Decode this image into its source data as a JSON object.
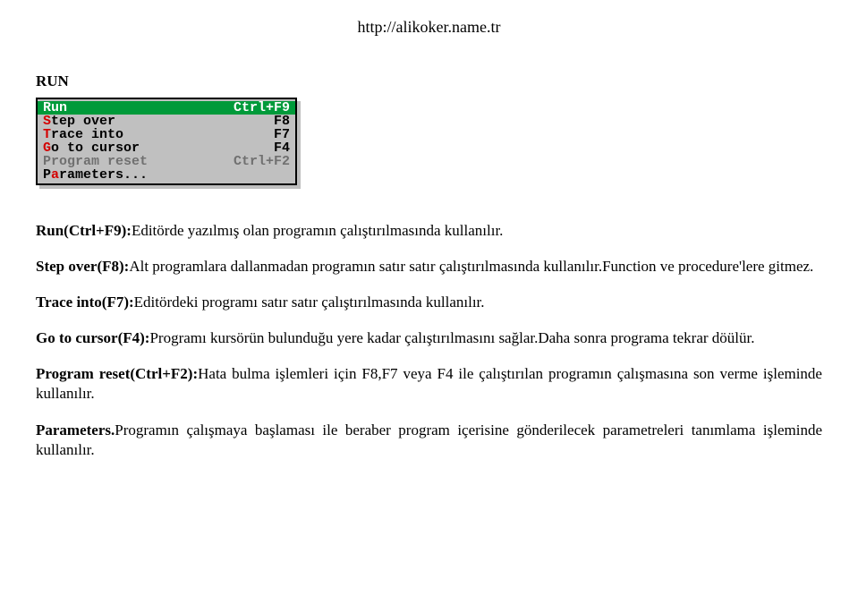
{
  "header": {
    "url": "http://alikoker.name.tr"
  },
  "section": {
    "title": "RUN"
  },
  "menu": {
    "items": [
      {
        "accel": "R",
        "rest": "un",
        "shortcut": "Ctrl+F9",
        "disabled": false,
        "selected": true
      },
      {
        "accel": "S",
        "rest": "tep over",
        "shortcut": "F8",
        "disabled": false,
        "selected": false
      },
      {
        "accel": "T",
        "rest": "race into",
        "shortcut": "F7",
        "disabled": false,
        "selected": false
      },
      {
        "accel": "G",
        "rest": "o to cursor",
        "shortcut": "F4",
        "disabled": false,
        "selected": false
      },
      {
        "accel": "P",
        "rest": "rogram reset",
        "shortcut": "Ctrl+F2",
        "disabled": true,
        "selected": false
      },
      {
        "accel": "a",
        "pre": "P",
        "rest": "rameters...",
        "shortcut": "",
        "disabled": false,
        "selected": false
      }
    ]
  },
  "paras": {
    "p1": {
      "term": "Run(Ctrl+F9):",
      "rest": "Editörde yazılmış olan programın çalıştırılmasında kullanılır."
    },
    "p2": {
      "term": "Step over(F8):",
      "rest": "Alt programlara dallanmadan programın satır satır çalıştırılmasında kullanılır.Function ve procedure'lere gitmez."
    },
    "p3": {
      "term": "Trace into(F7):",
      "rest": "Editördeki programı satır satır çalıştırılmasında kullanılır."
    },
    "p4": {
      "term": "Go to cursor(F4):",
      "rest": "Programı kursörün bulunduğu yere kadar  çalıştırılmasını sağlar.Daha sonra programa tekrar döülür."
    },
    "p5": {
      "term": "Program reset(Ctrl+F2):",
      "rest": "Hata bulma işlemleri için F8,F7 veya F4 ile çalıştırılan programın çalışmasına son verme işleminde kullanılır."
    },
    "p6": {
      "term": "Parameters.",
      "rest": "Programın çalışmaya başlaması ile beraber program içerisine gönderilecek parametreleri tanımlama işleminde kullanılır."
    }
  }
}
